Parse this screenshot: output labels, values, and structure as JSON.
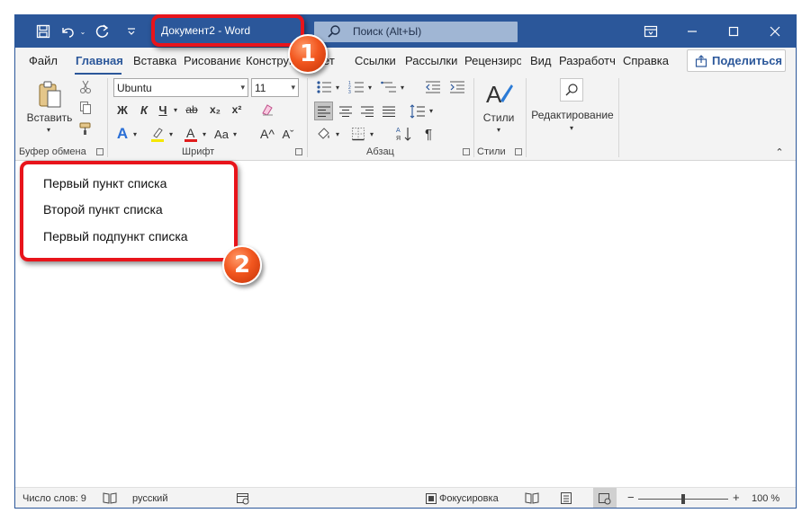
{
  "titlebar": {
    "title": "Документ2  -  Word",
    "search_placeholder": "Поиск (Alt+Ы)"
  },
  "tabs": [
    {
      "label": "Файл"
    },
    {
      "label": "Главная"
    },
    {
      "label": "Вставка"
    },
    {
      "label": "Рисование"
    },
    {
      "label": "Конструктор"
    },
    {
      "label": "Макет"
    },
    {
      "label": "Ссылки"
    },
    {
      "label": "Рассылки"
    },
    {
      "label": "Рецензирование"
    },
    {
      "label": "Вид"
    },
    {
      "label": "Разработчик"
    },
    {
      "label": "Справка"
    }
  ],
  "share_label": "Поделиться",
  "ribbon": {
    "paste_label": "Вставить",
    "clipboard_group": "Буфер обмена",
    "font_group": "Шрифт",
    "font_name": "Ubuntu",
    "font_size": "11",
    "bold": "Ж",
    "italic": "К",
    "underline": "Ч",
    "strike": "ab",
    "subscript": "x₂",
    "superscript": "x²",
    "grow_font": "A^",
    "shrink_font": "Aˇ",
    "change_case": "Aa",
    "paragraph_group": "Абзац",
    "styles_label": "Стили",
    "styles_group": "Стили",
    "editing_label": "Редактирование"
  },
  "document": {
    "lines": [
      "Первый пункт списка",
      "Второй пункт списка",
      "Первый подпункт списка"
    ]
  },
  "statusbar": {
    "word_count": "Число слов: 9",
    "language": "русский",
    "focus": "Фокусировка",
    "zoom": "100 %",
    "zoom_minus": "−",
    "zoom_plus": "+"
  },
  "callouts": {
    "one": "1",
    "two": "2"
  },
  "colors": {
    "accent": "#2b579a",
    "callout": "#e8141b",
    "badge": "#f2571f"
  }
}
